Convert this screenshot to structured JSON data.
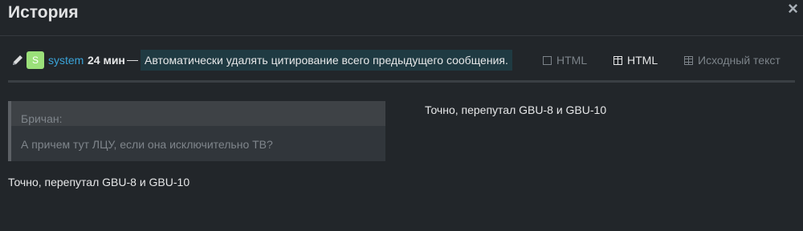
{
  "modal": {
    "title": "История",
    "close_icon": "×"
  },
  "revision": {
    "avatar_letter": "S",
    "username": "system",
    "age": "24 мин",
    "dash": "—",
    "edit_reason": "Автоматически удалять цитирование всего предыдущего сообщения."
  },
  "view_modes": {
    "inline": "HTML",
    "side_by_side": "HTML",
    "raw": "Исходный текст",
    "active": "side_by_side"
  },
  "before": {
    "quote_author": "Бричан:",
    "quote_text": "А причем тут ЛЦУ, если она исключительно ТВ?",
    "text": "Точно, перепутал GBU-8 и GBU-10"
  },
  "after": {
    "text": "Точно, перепутал GBU-8 и GBU-10"
  },
  "colors": {
    "background": "#22262a",
    "username": "#3aa3d8",
    "avatar": "#9be07a",
    "edit_reason_bg": "#1f3a42"
  }
}
